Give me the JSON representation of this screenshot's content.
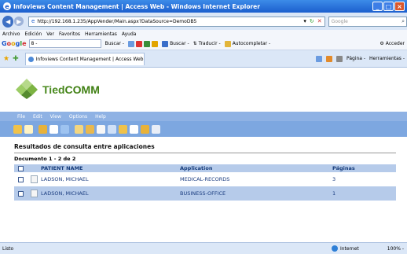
{
  "window": {
    "title": "Infoviews Content Management | Access Web - Windows Internet Explorer"
  },
  "address": {
    "url": "http://192.168.1.235/AppVender/Main.aspx?DataSource=DemoDB5",
    "search_placeholder": "Google"
  },
  "menubar": [
    "Archivo",
    "Edición",
    "Ver",
    "Favoritos",
    "Herramientas",
    "Ayuda"
  ],
  "googlebar": {
    "search_value": "8 -",
    "buscar": "Buscar -",
    "buscar2": "Buscar -",
    "traducir": "Traducir -",
    "autocompletar": "Autocompletar -",
    "acceder": "Acceder"
  },
  "tabbar": {
    "tab_title": "Infoviews Content Management | Access Web",
    "pagina": "Página -",
    "herramientas": "Herramientas -"
  },
  "app": {
    "logo_part1": "Tied",
    "logo_part2": "COMM",
    "menu": [
      "File",
      "Edit",
      "View",
      "Options",
      "Help"
    ],
    "results_title": "Resultados de consulta entre aplicaciones",
    "doc_count": "Documento 1 - 2 de 2",
    "columns": {
      "name": "PATIENT NAME",
      "application": "Application",
      "pages": "Páginas"
    },
    "rows": [
      {
        "name": "LADSON, MICHAEL",
        "application": "MEDICAL-RECORDS",
        "pages": "3"
      },
      {
        "name": "LADSON, MICHAEL",
        "application": "BUSINESS-OFFICE",
        "pages": "1"
      }
    ]
  },
  "status": {
    "left": "Listo",
    "zone": "Internet",
    "zoom": "100% -"
  }
}
